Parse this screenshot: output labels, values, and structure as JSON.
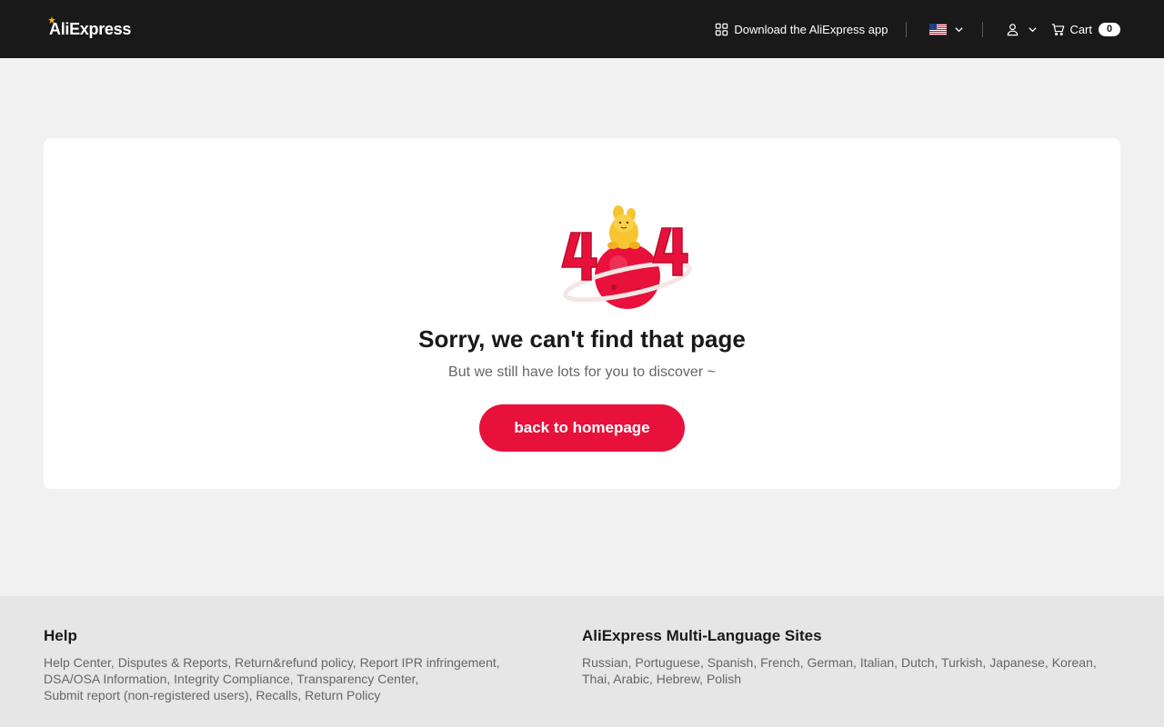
{
  "header": {
    "logo": "AliExpress",
    "download_app": "Download the AliExpress app",
    "cart_label": "Cart",
    "cart_count": "0",
    "icons": [
      "qr-icon",
      "us-flag-icon",
      "chevron-down-icon",
      "user-icon",
      "cart-icon"
    ]
  },
  "main": {
    "title": "Sorry, we can't find that page",
    "subtitle": "But we still have lots for you to discover ~",
    "button": "back to homepage",
    "accent_color": "#e8113b"
  },
  "footer": {
    "help": {
      "heading": "Help",
      "lines": [
        "Help Center, Disputes & Reports, Return&refund policy, Report IPR infringement,",
        "DSA/OSA Information, Integrity Compliance, Transparency Center,",
        "Submit report (non-registered users), Recalls, Return Policy"
      ]
    },
    "languages": {
      "heading": "AliExpress Multi-Language Sites",
      "lines": [
        "Russian, Portuguese, Spanish, French, German, Italian, Dutch, Turkish, Japanese, Korean,",
        "Thai, Arabic, Hebrew, Polish"
      ]
    }
  }
}
